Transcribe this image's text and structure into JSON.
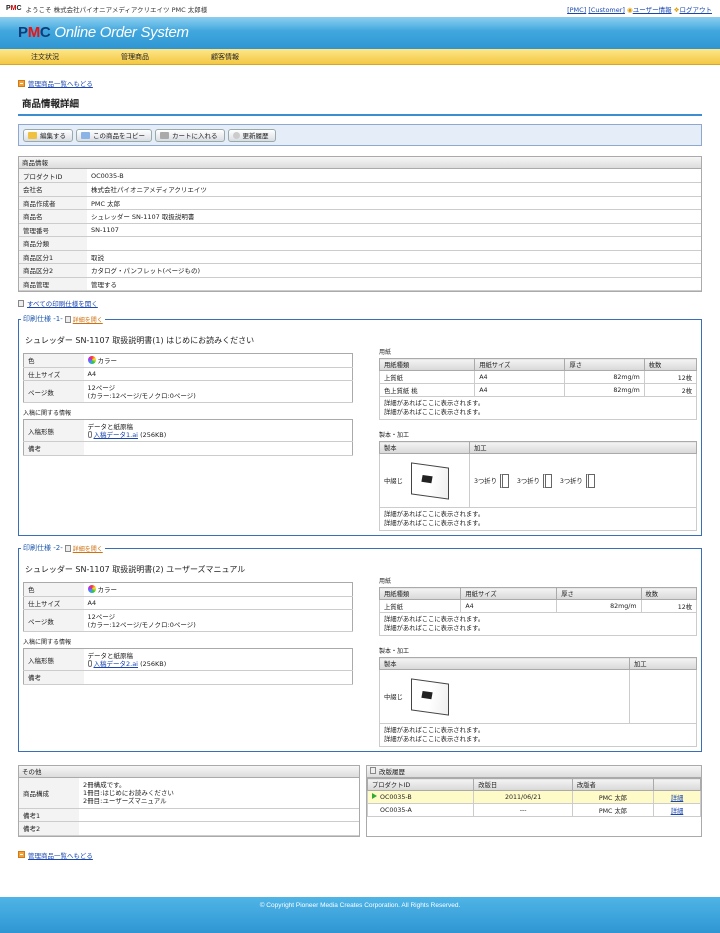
{
  "topbar": {
    "logo_text": "PMC",
    "welcome": "ようこそ 株式会社パイオニアメディアクリエイツ PMC 太郎様",
    "link_pmc": "[PMC]",
    "link_customer": "[Customer]",
    "user_info": "ユーザー情報",
    "logout": "ログアウト"
  },
  "header": {
    "logo_brand": "PMC",
    "logo_text": "Online Order System"
  },
  "nav": [
    "注文状況",
    "管理商品",
    "顧客情報"
  ],
  "back_link": "管理商品一覧へもどる",
  "page_title": "商品情報詳細",
  "toolbar": {
    "edit": "編集する",
    "copy": "この商品をコピー",
    "cart": "カートに入れる",
    "history": "更新履歴"
  },
  "product_info": {
    "heading": "商品情報",
    "rows": [
      {
        "k": "プロダクトID",
        "v": "OC0035-B"
      },
      {
        "k": "会社名",
        "v": "株式会社パイオニアメディアクリエイツ"
      },
      {
        "k": "商品作成者",
        "v": "PMC 太郎"
      },
      {
        "k": "商品名",
        "v": "シュレッダー SN-1107 取扱説明書"
      },
      {
        "k": "管理番号",
        "v": "SN-1107"
      },
      {
        "k": "商品分類",
        "v": ""
      },
      {
        "k": "商品区分1",
        "v": "取説"
      },
      {
        "k": "商品区分2",
        "v": "カタログ・パンフレット(ページもの)"
      },
      {
        "k": "商品管理",
        "v": "管理する"
      }
    ]
  },
  "open_all": "すべての印刷仕様を開く",
  "specs": [
    {
      "legend": "印刷仕様 -1-",
      "open_detail": "詳細を開く",
      "title": "シュレッダー SN-1107 取扱説明書(1) はじめにお読みください",
      "color_label": "色",
      "color_value": "カラー",
      "size_label": "仕上サイズ",
      "size_value": "A4",
      "pages_label": "ページ数",
      "pages_value1": "12ページ",
      "pages_value2": "(カラー:12ページ/モノクロ:0ページ)",
      "submit_heading": "入稿に関する情報",
      "form_label": "入稿形態",
      "form_value": "データと紙原稿",
      "file_link": "入稿データ1.ai",
      "file_size": "(256KB)",
      "remarks_label": "備考",
      "paper_heading": "用紙",
      "paper_cols": [
        "用紙種類",
        "用紙サイズ",
        "厚さ",
        "枚数"
      ],
      "paper_rows": [
        [
          "上質紙",
          "A4",
          "82mg/m",
          "12枚"
        ],
        [
          "色上質紙 桃",
          "A4",
          "82mg/m",
          "2枚"
        ]
      ],
      "paper_note1": "詳細があればここに表示されます。",
      "paper_note2": "詳細があればここに表示されます。",
      "bind_heading": "製本・加工",
      "bind_cols": [
        "製本",
        "加工"
      ],
      "bind_type": "中綴じ",
      "book_label": "中綴じ",
      "folds": [
        "3つ折り",
        "3つ折り",
        "3つ折り"
      ],
      "bind_note1": "詳細があればここに表示されます。",
      "bind_note2": "詳細があればここに表示されます。"
    },
    {
      "legend": "印刷仕様 -2-",
      "open_detail": "詳細を開く",
      "title": "シュレッダー SN-1107 取扱説明書(2) ユーザーズマニュアル",
      "color_label": "色",
      "color_value": "カラー",
      "size_label": "仕上サイズ",
      "size_value": "A4",
      "pages_label": "ページ数",
      "pages_value1": "12ページ",
      "pages_value2": "(カラー:12ページ/モノクロ:0ページ)",
      "submit_heading": "入稿に関する情報",
      "form_label": "入稿形態",
      "form_value": "データと紙原稿",
      "file_link": "入稿データ2.ai",
      "file_size": "(256KB)",
      "remarks_label": "備考",
      "paper_heading": "用紙",
      "paper_cols": [
        "用紙種類",
        "用紙サイズ",
        "厚さ",
        "枚数"
      ],
      "paper_rows": [
        [
          "上質紙",
          "A4",
          "82mg/m",
          "12枚"
        ]
      ],
      "paper_note1": "詳細があればここに表示されます。",
      "paper_note2": "詳細があればここに表示されます。",
      "bind_heading": "製本・加工",
      "bind_cols": [
        "製本",
        "加工"
      ],
      "bind_type": "中綴じ",
      "book_label": "中綴じ",
      "folds": [],
      "bind_note1": "詳細があればここに表示されます。",
      "bind_note2": "詳細があればここに表示されます。"
    }
  ],
  "other": {
    "heading": "その他",
    "composition_label": "商品構成",
    "composition_lines": [
      "2冊構成です。",
      "1冊目:はじめにお読みください",
      "2冊目:ユーザーズマニュアル"
    ],
    "remarks1": "備考1",
    "remarks2": "備考2"
  },
  "revision": {
    "heading": "改版履歴",
    "cols": [
      "プロダクトID",
      "改版日",
      "改版者",
      ""
    ],
    "rows": [
      [
        "OC0035-B",
        "2011/06/21",
        "PMC 太郎",
        "詳細"
      ],
      [
        "OC0035-A",
        "---",
        "PMC 太郎",
        "詳細"
      ]
    ]
  },
  "back_link_bottom": "管理商品一覧へもどる",
  "footer": "© Copyright Pioneer Media Creates Corporation. All Rights Reserved."
}
